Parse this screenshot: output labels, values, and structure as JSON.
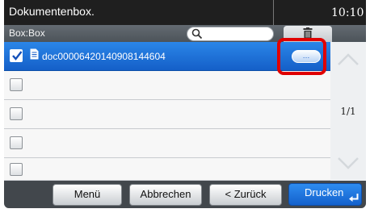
{
  "header": {
    "title": "Dokumentenbox.",
    "time": "10:10"
  },
  "pathbar": {
    "path": "Box:Box",
    "search_placeholder": ""
  },
  "list": {
    "rows": [
      {
        "name": "doc00006420140908144604",
        "checked": true,
        "selected": true
      },
      {
        "name": "",
        "checked": false,
        "selected": false
      },
      {
        "name": "",
        "checked": false,
        "selected": false
      },
      {
        "name": "",
        "checked": false,
        "selected": false
      }
    ],
    "detail_button_label": "…"
  },
  "pager": {
    "page_indicator": "1/1"
  },
  "bottombar": {
    "menu_label": "Menü",
    "cancel_label": "Abbrechen",
    "back_label": "< Zurück",
    "print_label": "Drucken"
  },
  "colors": {
    "accent": "#1a6fd9",
    "highlight": "#e00000",
    "titlebar": "#1f1f1f"
  }
}
